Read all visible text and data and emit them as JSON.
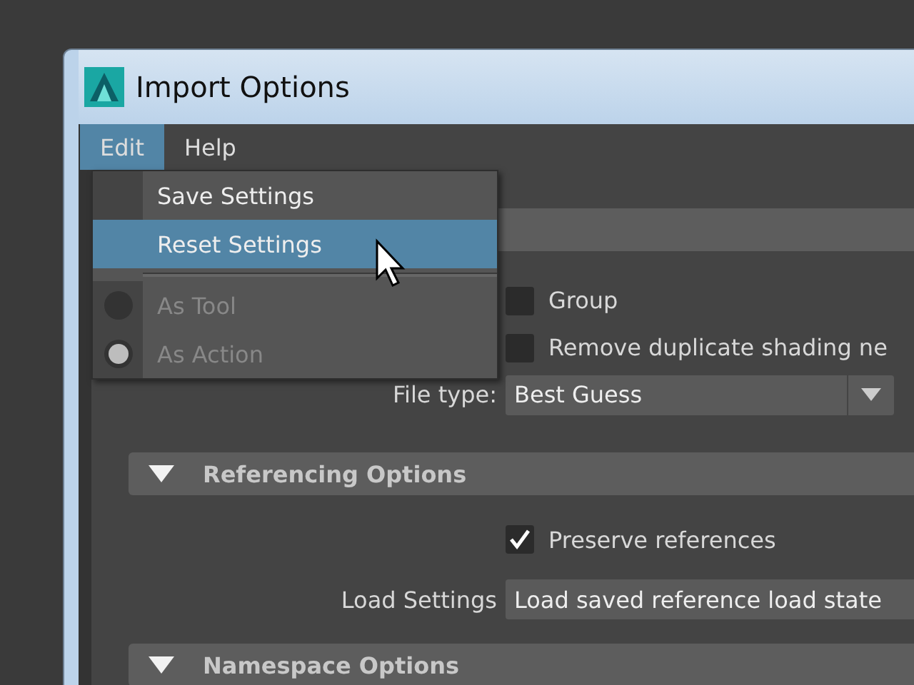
{
  "window": {
    "title": "Import Options"
  },
  "menu_bar": [
    {
      "label": "Edit",
      "selected": true
    },
    {
      "label": "Help",
      "selected": false
    }
  ],
  "edit_menu": {
    "items": [
      {
        "kind": "command",
        "label": "Save Settings",
        "highlighted": false
      },
      {
        "kind": "command",
        "label": "Reset Settings",
        "highlighted": true
      },
      {
        "kind": "separator"
      },
      {
        "kind": "radio",
        "label": "As Tool",
        "selected": false,
        "disabled": true
      },
      {
        "kind": "radio",
        "label": "As Action",
        "selected": true,
        "disabled": true
      }
    ]
  },
  "options": [
    {
      "kind": "checkbox",
      "label": "Group",
      "checked": false
    },
    {
      "kind": "checkbox",
      "label": "Remove duplicate shading ne",
      "checked": false
    },
    {
      "kind": "dropdown",
      "label": "File type:",
      "value": "Best Guess"
    }
  ],
  "sections": [
    {
      "title": "Referencing Options",
      "expanded": true,
      "rows": [
        {
          "kind": "checkbox",
          "label": "Preserve references",
          "checked": true
        },
        {
          "kind": "dropdown",
          "label": "Load Settings",
          "value": "Load saved reference load state"
        }
      ]
    },
    {
      "title": "Namespace Options",
      "expanded": true
    }
  ]
}
